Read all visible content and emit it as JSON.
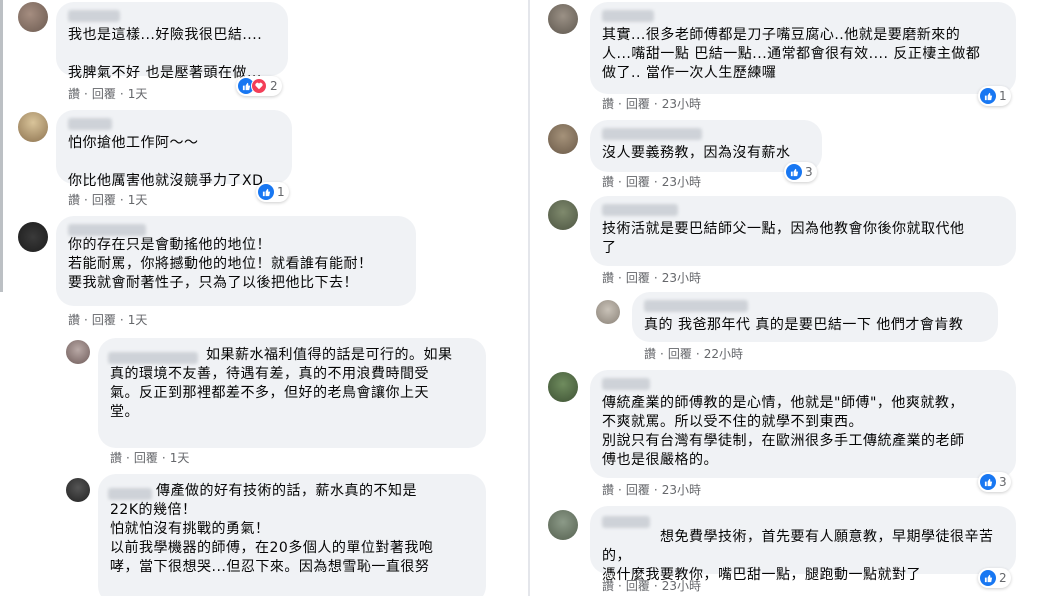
{
  "ui": {
    "like_label": "讚",
    "reply_label": "回覆",
    "dot": "·"
  },
  "colors": {
    "bubble_bg": "#f0f2f5",
    "meta_text": "#65676b",
    "like_blue": "#1877f2",
    "love_red": "#f33e58"
  },
  "left_comments": [
    {
      "lines": "我也是這樣...好險我很巴結....\n\n我脾氣不好 也是壓著頭在做...",
      "time": "1天",
      "reaction_count": "2",
      "reactions": [
        "like-icon",
        "heart-icon"
      ]
    },
    {
      "lines": "怕你搶他工作阿～～\n\n你比他厲害他就沒競爭力了XD",
      "time": "1天",
      "reaction_count": "1",
      "reactions": [
        "like-icon"
      ]
    },
    {
      "lines": "你的存在只是會動搖他的地位！\n若能耐罵，你將撼動他的地位！就看誰有能耐！\n要我就會耐著性子，只為了以後把他比下去！",
      "time": "1天",
      "reaction_count": "",
      "reactions": []
    },
    {
      "lines": "如果薪水福利值得的話是可行的。如果\n真的環境不友善，待遇有差，真的不用浪費時間受\n氣。反正到那裡都差不多，但好的老鳥會讓你上天\n堂。",
      "time": "1天",
      "reaction_count": "",
      "reactions": []
    },
    {
      "lines": "傳產做的好有技術的話，薪水真的不知是\n22K的幾倍！\n怕就怕沒有挑戰的勇氣！\n以前我學機器的師傅，在20多個人的單位對著我咆\n哮，當下很想哭...但忍下來。因為想雪恥一直很努",
      "time": "",
      "reaction_count": "",
      "reactions": []
    }
  ],
  "right_comments": [
    {
      "lines": "其實...很多老師傅都是刀子嘴豆腐心..他就是要磨新來的\n人...嘴甜一點 巴結一點...通常都會很有效.... 反正棲主做都\n做了.. 當作一次人生歷練囉",
      "time": "23小時",
      "reaction_count": "1",
      "reactions": [
        "like-icon"
      ]
    },
    {
      "lines": "沒人要義務教，因為沒有薪水",
      "time": "23小時",
      "reaction_count": "3",
      "reactions": [
        "like-icon"
      ]
    },
    {
      "lines": "技術活就是要巴結師父一點，因為他教會你後你就取代他\n了",
      "time": "23小時",
      "reaction_count": "",
      "reactions": []
    },
    {
      "lines": "真的 我爸那年代 真的是要巴結一下 他們才會肯教",
      "time": "22小時",
      "reaction_count": "",
      "reactions": []
    },
    {
      "lines": "傳統產業的師傅教的是心情，他就是\"師傅\"，他爽就教，\n不爽就罵。所以受不住的就學不到東西。\n別說只有台灣有學徒制，在歐洲很多手工傳統產業的老師\n傅也是很嚴格的。",
      "time": "23小時",
      "reaction_count": "3",
      "reactions": [
        "like-icon"
      ]
    },
    {
      "lines": "想免費學技術，首先要有人願意教，早期學徒很辛苦的，\n憑什麼我要教你，嘴巴甜一點，腿跑動一點就對了",
      "time": "23小時",
      "reaction_count": "2",
      "reactions": [
        "like-icon"
      ]
    }
  ]
}
